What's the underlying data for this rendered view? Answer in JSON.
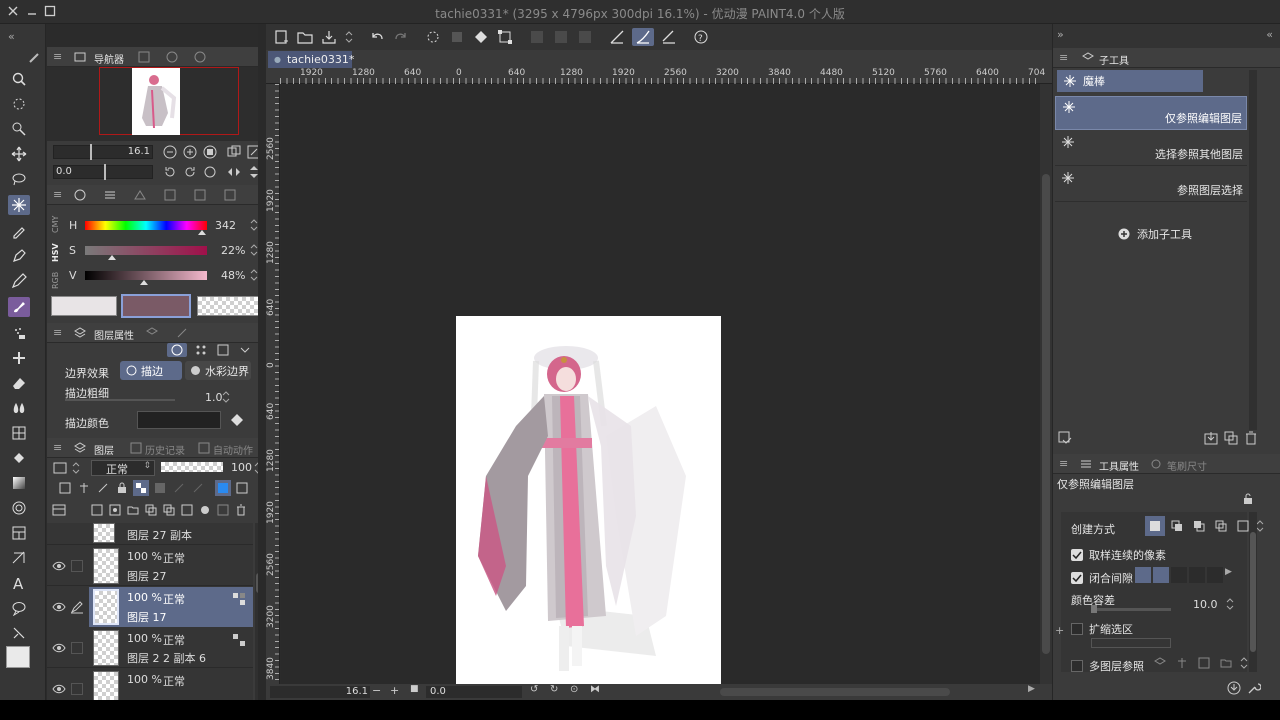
{
  "window": {
    "title": "tachie0331* (3295 x 4796px 300dpi 16.1%) - 优动漫 PAINT4.0 个人版"
  },
  "navigator": {
    "tab_label": "导航器",
    "zoom": "16.1",
    "angle": "0.0"
  },
  "color": {
    "modes": [
      "RGB",
      "HSV",
      "CMY"
    ],
    "h_label": "H",
    "h_value": "342",
    "s_label": "S",
    "s_value": "22%",
    "v_label": "V",
    "v_value": "48%",
    "main_color": "#e8e4e6",
    "sub_color": "#7a5a66"
  },
  "layer_props": {
    "tab_label": "图层属性",
    "border_effect_label": "边界效果",
    "border_option1": "描边",
    "border_option2": "水彩边界",
    "stroke_width_label": "描边粗细",
    "stroke_width_value": "1.0",
    "stroke_color_label": "描边颜色"
  },
  "layers": {
    "tab_label": "图层",
    "tab2_label": "历史记录",
    "tab3_label": "自动动作",
    "blend_mode": "正常",
    "opacity": "100",
    "items": [
      {
        "opacity": "",
        "mode": "",
        "name": "图层 27 副本"
      },
      {
        "opacity": "100 %",
        "mode": "正常",
        "name": "图层 27"
      },
      {
        "opacity": "100 %",
        "mode": "正常",
        "name": "图层 17"
      },
      {
        "opacity": "100 %",
        "mode": "正常",
        "name": "图层 2 2 副本 6"
      },
      {
        "opacity": "100 %",
        "mode": "正常",
        "name": ""
      }
    ]
  },
  "canvas": {
    "tab_label": "tachie0331*",
    "ruler_top": [
      "1920",
      "1280",
      "640",
      "0",
      "640",
      "1280",
      "1920",
      "2560",
      "3200",
      "3840",
      "4480",
      "5120",
      "5760",
      "6400",
      "704"
    ],
    "ruler_left": [
      "2560",
      "1920",
      "1280",
      "640",
      "0",
      "640",
      "1280",
      "1920",
      "2560",
      "3200",
      "3840"
    ],
    "zoom": "16.1",
    "angle": "0.0"
  },
  "subtool": {
    "tab_label": "子工具",
    "group_label": "魔棒",
    "items": [
      "仅参照编辑图层",
      "选择参照其他图层",
      "参照图层选择"
    ],
    "add_label": "添加子工具"
  },
  "toolprops": {
    "tab_label": "工具属性",
    "tab2_label": "笔刷尺寸",
    "tool_name": "仅参照编辑图层",
    "create_method_label": "创建方式",
    "contiguous_label": "取样连续的像素",
    "close_gap_label": "闭合间隙",
    "tolerance_label": "颜色容差",
    "tolerance_value": "10.0",
    "expand_label": "扩缩选区",
    "multi_ref_label": "多图层参照"
  }
}
